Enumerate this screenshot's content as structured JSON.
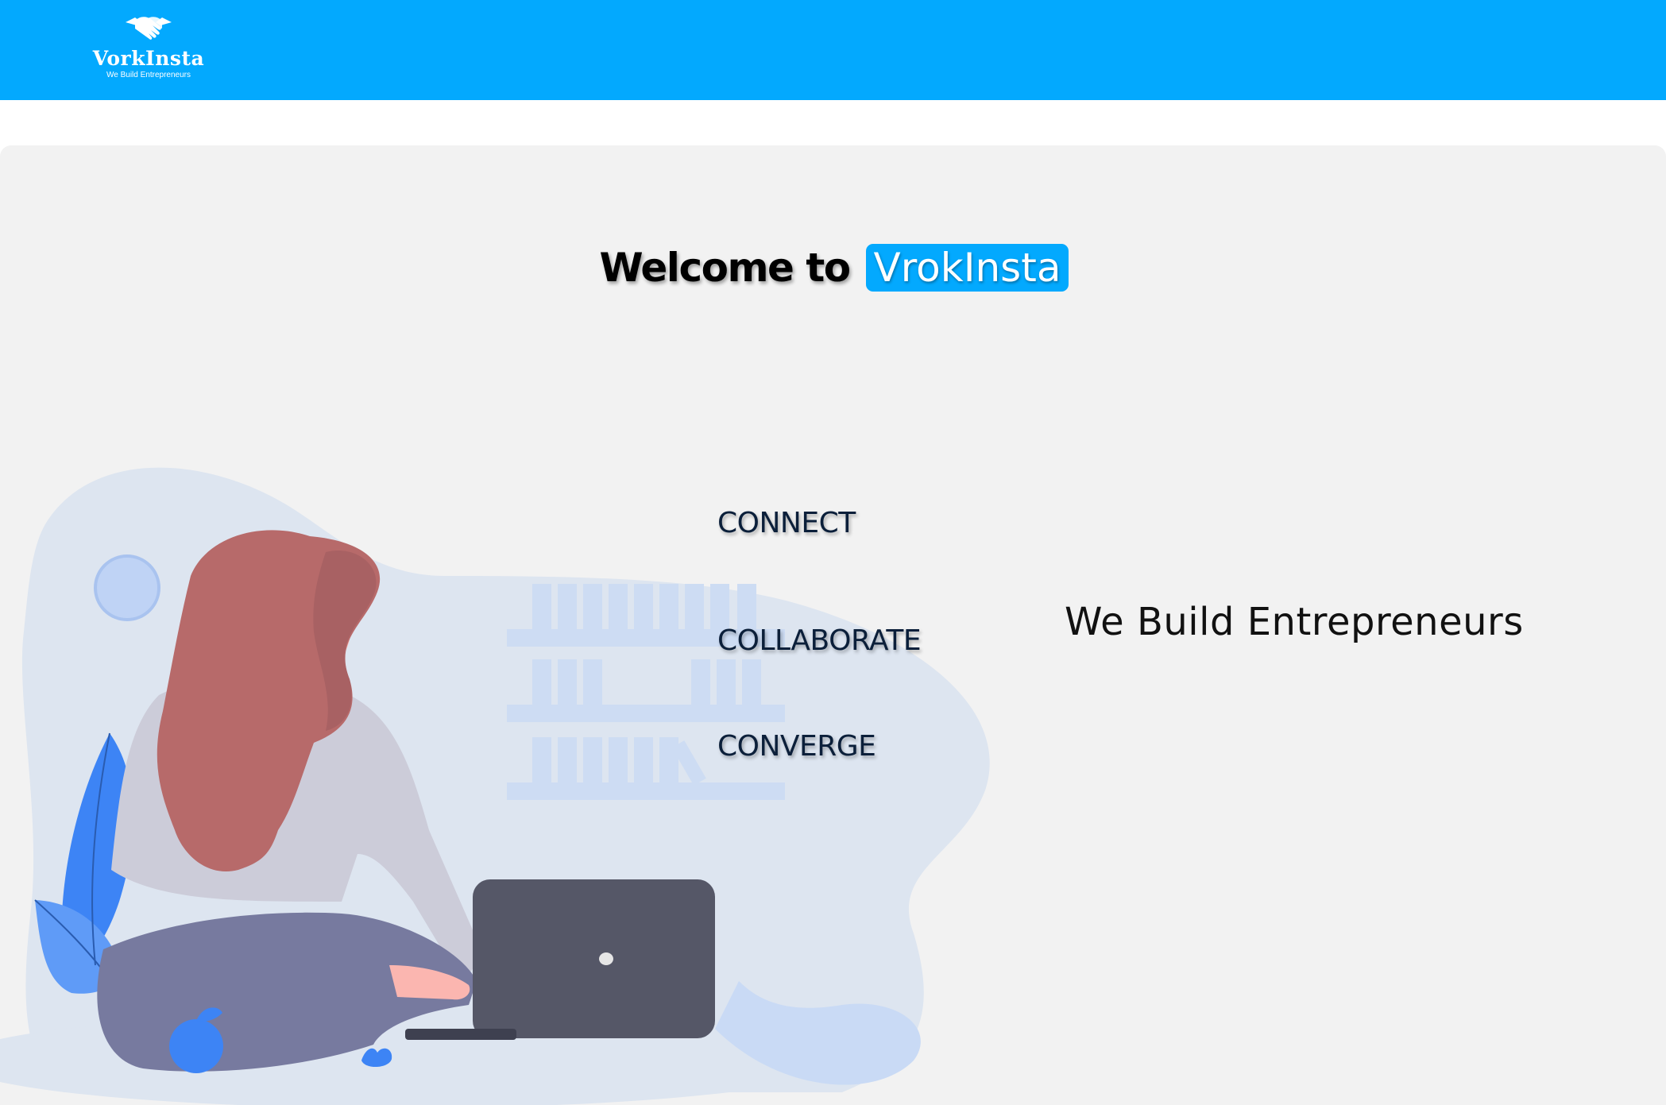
{
  "navbar": {
    "brand_name": "VorkInsta",
    "brand_tagline": "We Build Entrepreneurs",
    "logo_icon": "handshake-icon",
    "background_color": "#03a9fe"
  },
  "hero": {
    "welcome_prefix": "Welcome to",
    "welcome_brand": "VrokInsta",
    "accent_color": "#03a9fe",
    "panel_color": "#f2f2f2"
  },
  "pillars": [
    "CONNECT",
    "COLLABORATE",
    "CONVERGE"
  ],
  "tagline": "We Build Entrepreneurs",
  "illustration": {
    "subject": "woman-with-laptop-illustration",
    "hair_color": "#b76a6a",
    "laptop_color": "#555767",
    "leaf_color": "#3d84f5"
  }
}
